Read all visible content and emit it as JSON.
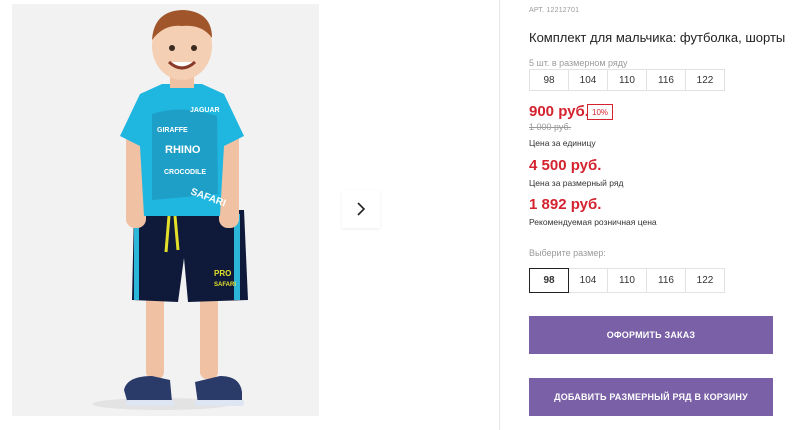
{
  "product": {
    "sku": "АРТ. 12212701",
    "title": "Комплект для мальчика: футболка, шорты",
    "sizes_note": "5 шт. в размерном ряду",
    "size_range": [
      "98",
      "104",
      "110",
      "116",
      "122"
    ],
    "price": "900 руб.",
    "discount": "10%",
    "old_price": "1 000 руб.",
    "price_caption": "Цена за единицу",
    "range_price": "4 500 руб.",
    "range_price_caption": "Цена за размерный ряд",
    "rrp": "1 892 руб.",
    "rrp_caption": "Рекомендуемая розничная цена",
    "choose_size_label": "Выберите размер:",
    "size_options": [
      "98",
      "104",
      "110",
      "116",
      "122"
    ],
    "selected_size": "98"
  },
  "actions": {
    "order": "ОФОРМИТЬ ЗАКАЗ",
    "add_range": "ДОБАВИТЬ РАЗМЕРНЫЙ РЯД В КОРЗИНУ"
  },
  "photo": {
    "tshirt_print": [
      "GIRAFFE",
      "JAGUAR",
      "RHINO",
      "CROCODILE",
      "SAFARI"
    ],
    "shorts_print": [
      "PRO",
      "SAFARI"
    ]
  },
  "colors": {
    "accent_button": "#7a60a7",
    "price_red": "#d4232f",
    "tshirt": "#1fb6e0",
    "shorts": "#0f1a3a",
    "shorts_stripe": "#2bb5d9",
    "drawstring": "#e4e02a"
  },
  "icons": {
    "next": "chevron-right-icon"
  }
}
